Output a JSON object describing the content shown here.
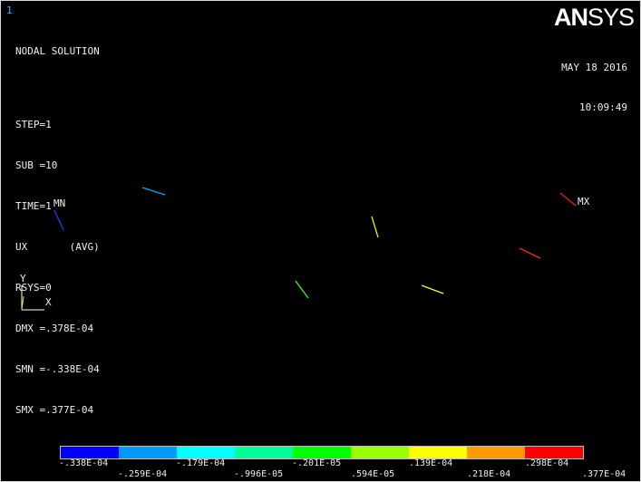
{
  "window_number": "1",
  "info_lines": [
    "NODAL SOLUTION",
    "",
    "STEP=1",
    "SUB =10",
    "TIME=1",
    "UX       (AVG)",
    "RSYS=0",
    "DMX =.378E-04",
    "SMN =-.338E-04",
    "SMX =.377E-04"
  ],
  "logo": {
    "an": "AN",
    "sys": "SYS"
  },
  "date": "MAY 18 2016",
  "time": "10:09:49",
  "markers": {
    "mn": "MN",
    "mx": "MX"
  },
  "triad": {
    "y": "Y",
    "x": "X"
  },
  "legend": {
    "colors": [
      "#0000ff",
      "#0099ff",
      "#00ffff",
      "#00ff99",
      "#00ff00",
      "#99ff00",
      "#ffff00",
      "#ff9900",
      "#ff0000"
    ],
    "top_labels": [
      "-.338E-04",
      "-.179E-04",
      "-.201E-05",
      ".139E-04",
      ".298E-04"
    ],
    "bottom_labels": [
      "-.259E-04",
      "-.996E-05",
      ".594E-05",
      ".218E-04",
      ".377E-04"
    ]
  },
  "segments_colors": [
    "#00aaff",
    "#1a3cff",
    "#d7ff00",
    "#33ff22",
    "#eaff33",
    "#ff2a00",
    "#ff1a00"
  ]
}
